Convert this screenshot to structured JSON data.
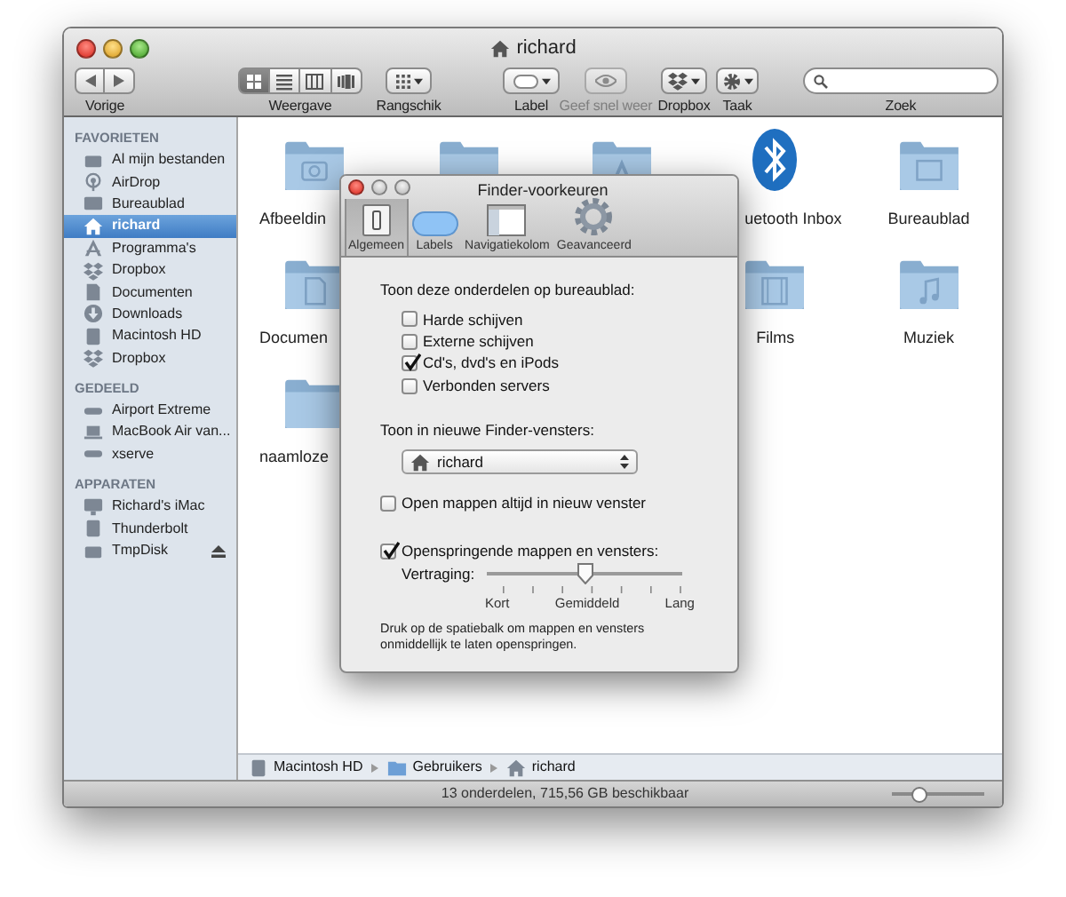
{
  "window": {
    "title": "richard"
  },
  "toolbar": [
    {
      "kind": "nav",
      "label": "Vorige",
      "disabled": false
    },
    {
      "kind": "views",
      "label": "Weergave",
      "disabled": false,
      "views": [
        {
          "selected": true
        },
        {
          "selected": false
        },
        {
          "selected": false
        },
        {
          "selected": false
        }
      ]
    },
    {
      "kind": "arrange",
      "label": "Rangschik",
      "disabled": false
    },
    {
      "kind": "label",
      "label": "Label",
      "disabled": false
    },
    {
      "kind": "quicklook",
      "label": "Geef snel weer",
      "disabled": true
    },
    {
      "kind": "dropbox",
      "label": "Dropbox",
      "disabled": false
    },
    {
      "kind": "action",
      "label": "Taak",
      "disabled": false
    },
    {
      "kind": "search",
      "label": "Zoek",
      "disabled": false
    }
  ],
  "sidebar": [
    {
      "heading": "FAVORIETEN",
      "items": [
        {
          "kind": "disk",
          "label": "Al mijn bestanden",
          "selected": false,
          "eject": false
        },
        {
          "kind": "airdrop",
          "label": "AirDrop",
          "selected": false,
          "eject": false
        },
        {
          "kind": "desktop",
          "label": "Bureaublad",
          "selected": false,
          "eject": false
        },
        {
          "kind": "home",
          "label": "richard",
          "selected": true,
          "eject": false
        },
        {
          "kind": "apps",
          "label": "Programma's",
          "selected": false,
          "eject": false
        },
        {
          "kind": "dropbox",
          "label": "Dropbox",
          "selected": false,
          "eject": false
        },
        {
          "kind": "docs",
          "label": "Documenten",
          "selected": false,
          "eject": false
        },
        {
          "kind": "downloads",
          "label": "Downloads",
          "selected": false,
          "eject": false
        },
        {
          "kind": "hd",
          "label": "Macintosh HD",
          "selected": false,
          "eject": false
        },
        {
          "kind": "dropbox",
          "label": "Dropbox",
          "selected": false,
          "eject": false
        }
      ]
    },
    {
      "heading": "GEDEELD",
      "items": [
        {
          "kind": "network",
          "label": "Airport Extreme",
          "selected": false,
          "eject": false
        },
        {
          "kind": "laptop",
          "label": "MacBook Air van...",
          "selected": false,
          "eject": false
        },
        {
          "kind": "network",
          "label": "xserve",
          "selected": false,
          "eject": false
        }
      ]
    },
    {
      "heading": "APPARATEN",
      "items": [
        {
          "kind": "imac",
          "label": "Richard's iMac",
          "selected": false,
          "eject": false
        },
        {
          "kind": "hd",
          "label": "Thunderbolt",
          "selected": false,
          "eject": false
        },
        {
          "kind": "disk",
          "label": "TmpDisk",
          "selected": false,
          "eject": true
        }
      ]
    }
  ],
  "files": {
    "rows": [
      [
        {
          "kind": "photo",
          "label": "Afbeeldin",
          "covered": true
        },
        {
          "kind": "plain"
        },
        {
          "kind": "apps"
        },
        {
          "kind": "bluetooth",
          "label": "uetooth Inbox",
          "covered": true
        },
        {
          "kind": "desktop",
          "label": "Bureaublad",
          "covered": false
        }
      ],
      [
        {
          "kind": "docs",
          "label": "Documen",
          "covered": true
        },
        null,
        null,
        {
          "kind": "films",
          "label": "Films",
          "covered": false
        },
        {
          "kind": "music",
          "label": "Muziek",
          "covered": false
        }
      ],
      [
        {
          "kind": "plain",
          "label": "naamloze",
          "covered": true
        }
      ]
    ]
  },
  "preferences": {
    "title": "Finder-voorkeuren",
    "tabs": [
      {
        "kind": "general",
        "label": "Algemeen",
        "selected": true
      },
      {
        "kind": "labels",
        "label": "Labels",
        "selected": false
      },
      {
        "kind": "sidebar",
        "label": "Navigatiekolom",
        "selected": false
      },
      {
        "kind": "advanced",
        "label": "Geavanceerd",
        "selected": false
      }
    ],
    "desktop_heading": "Toon deze onderdelen op bureaublad:",
    "desktop_items": [
      {
        "label": "Harde schijven",
        "checked": false
      },
      {
        "label": "Externe schijven",
        "checked": false
      },
      {
        "label": "Cd's, dvd's en iPods",
        "checked": true
      },
      {
        "label": "Verbonden servers",
        "checked": false
      }
    ],
    "new_window_heading": "Toon in nieuwe Finder-vensters:",
    "new_window_select": {
      "value": "richard"
    },
    "open_in_new_window": {
      "label": "Open mappen altijd in nieuw venster",
      "checked": false
    },
    "spring_loaded": {
      "label": "Openspringende mappen en vensters:",
      "checked": true
    },
    "delay": {
      "label": "Vertraging:",
      "level": 0.5,
      "ticks": [
        "Kort",
        "Gemiddeld",
        "Lang"
      ]
    },
    "hint": "Druk op de spatiebalk om mappen en vensters onmiddellijk te laten openspringen."
  },
  "path_bar": [
    {
      "kind": "hd",
      "label": "Macintosh HD"
    },
    {
      "kind": "folder",
      "label": "Gebruikers"
    },
    {
      "kind": "home",
      "label": "richard"
    }
  ],
  "status_bar": {
    "text": "13 onderdelen, 715,56 GB beschikbaar",
    "icon_size": {
      "level": 0.3
    }
  }
}
